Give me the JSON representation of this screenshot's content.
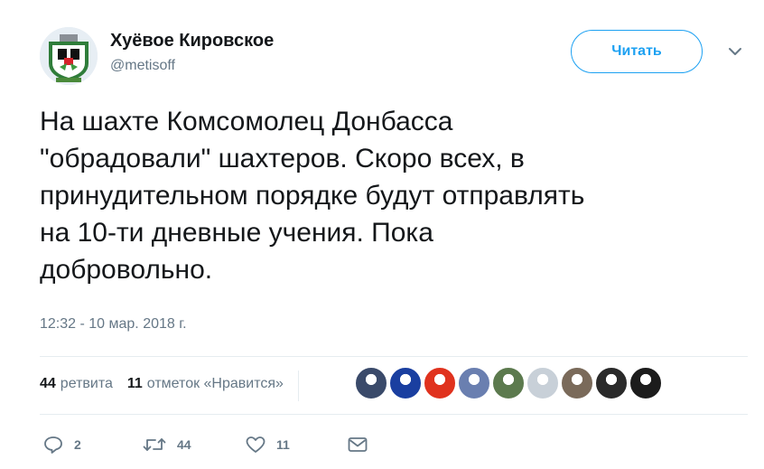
{
  "author": {
    "display_name": "Хуёвое Кировское",
    "handle": "@metisoff",
    "avatar_icon": "coat-of-arms-avatar"
  },
  "follow_button_label": "Читать",
  "tweet": {
    "text": "На шахте Комсомолец Донбасса\n\"обрадовали\" шахтеров. Скоро всех, в\nпринудительном порядке будут отправлять\nна 10-ти дневные учения. Пока\nдобровольно.",
    "timestamp": "12:32 - 10 мар. 2018 г."
  },
  "stats": {
    "retweets_count": "44",
    "retweets_label": "ретвита",
    "likes_count": "11",
    "likes_label": "отметок «Нравится»"
  },
  "likers": [
    {
      "name": "liker-avatar-1",
      "color": "#3a4a6a"
    },
    {
      "name": "liker-avatar-2",
      "color": "#1a3fa0"
    },
    {
      "name": "liker-avatar-3",
      "color": "#e0321e"
    },
    {
      "name": "liker-avatar-4",
      "color": "#6a7fb0"
    },
    {
      "name": "liker-avatar-5",
      "color": "#5c7a4e"
    },
    {
      "name": "liker-avatar-6",
      "color": "#c8d0d8"
    },
    {
      "name": "liker-avatar-7",
      "color": "#7a6a5a"
    },
    {
      "name": "liker-avatar-8",
      "color": "#2a2a2a"
    },
    {
      "name": "liker-avatar-9",
      "color": "#1c1c1c"
    }
  ],
  "actions": {
    "reply_count": "2",
    "retweet_count": "44",
    "like_count": "11"
  },
  "colors": {
    "accent": "#1da1f2",
    "text_primary": "#14171a",
    "text_secondary": "#657786",
    "divider": "#e6ecf0"
  }
}
